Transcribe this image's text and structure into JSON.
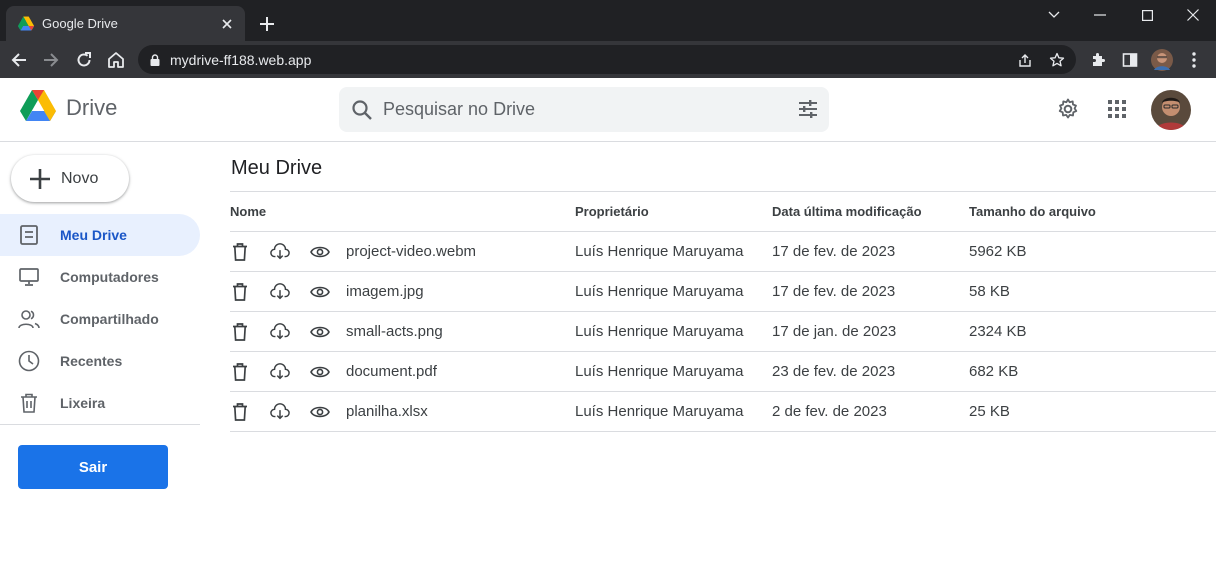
{
  "browser": {
    "tab_title": "Google Drive",
    "url": "mydrive-ff188.web.app"
  },
  "header": {
    "logo_text": "Drive",
    "search_placeholder": "Pesquisar no Drive"
  },
  "sidebar": {
    "new_label": "Novo",
    "items": [
      {
        "label": "Meu Drive",
        "icon": "my-drive-icon",
        "active": true
      },
      {
        "label": "Computadores",
        "icon": "computer-icon",
        "active": false
      },
      {
        "label": "Compartilhado",
        "icon": "shared-icon",
        "active": false
      },
      {
        "label": "Recentes",
        "icon": "clock-icon",
        "active": false
      },
      {
        "label": "Lixeira",
        "icon": "trash-icon",
        "active": false
      }
    ],
    "logout_label": "Sair"
  },
  "main": {
    "title": "Meu Drive",
    "columns": [
      "Nome",
      "Proprietário",
      "Data última modificação",
      "Tamanho do arquivo"
    ],
    "files": [
      {
        "name": "project-video.webm",
        "owner": "Luís Henrique Maruyama",
        "modified": "17 de fev. de 2023",
        "size": "5962 KB"
      },
      {
        "name": "imagem.jpg",
        "owner": "Luís Henrique Maruyama",
        "modified": "17 de fev. de 2023",
        "size": "58 KB"
      },
      {
        "name": "small-acts.png",
        "owner": "Luís Henrique Maruyama",
        "modified": "17 de jan. de 2023",
        "size": "2324 KB"
      },
      {
        "name": "document.pdf",
        "owner": "Luís Henrique Maruyama",
        "modified": "23 de fev. de 2023",
        "size": "682 KB"
      },
      {
        "name": "planilha.xlsx",
        "owner": "Luís Henrique Maruyama",
        "modified": "2 de fev. de 2023",
        "size": "25 KB"
      }
    ]
  },
  "colors": {
    "accent": "#1a73e8",
    "active_nav_bg": "#e8f0fe",
    "chrome_dark": "#202124"
  }
}
